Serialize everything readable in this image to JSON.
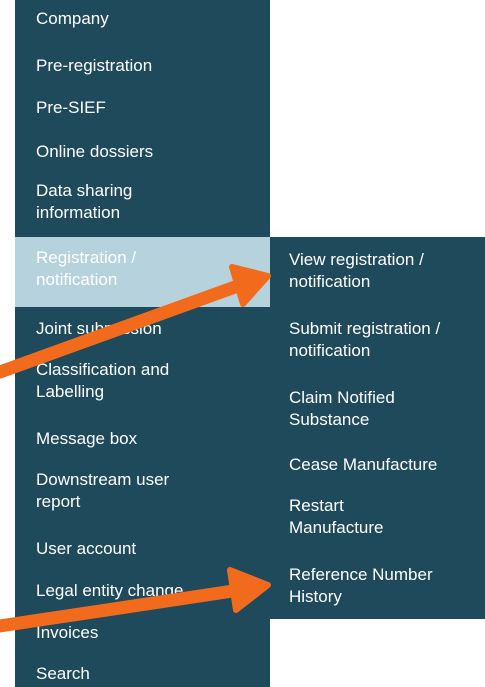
{
  "menu": {
    "items": [
      {
        "label": "Company"
      },
      {
        "label": "Pre-registration"
      },
      {
        "label": "Pre-SIEF"
      },
      {
        "label": "Online dossiers"
      },
      {
        "label": "Data sharing information"
      },
      {
        "label": "Registration / notification",
        "active": true
      },
      {
        "label": "Joint submission"
      },
      {
        "label": "Classification and Labelling"
      },
      {
        "label": "Message box"
      },
      {
        "label": "Downstream user report"
      },
      {
        "label": "User account"
      },
      {
        "label": "Legal entity change"
      },
      {
        "label": "Invoices"
      },
      {
        "label": "Search"
      }
    ]
  },
  "submenu": {
    "items": [
      {
        "label": "View registration / notification"
      },
      {
        "label": "Submit registration / notification"
      },
      {
        "label": "Claim Notified Substance"
      },
      {
        "label": "Cease Manufacture"
      },
      {
        "label": "Restart Manufacture"
      },
      {
        "label": "Reference Number History"
      }
    ]
  },
  "colors": {
    "menu_bg": "#1e4a5c",
    "active_bg": "#b6d3dd",
    "arrow": "#f26b1d"
  },
  "icons": [
    "arrow-icon"
  ]
}
